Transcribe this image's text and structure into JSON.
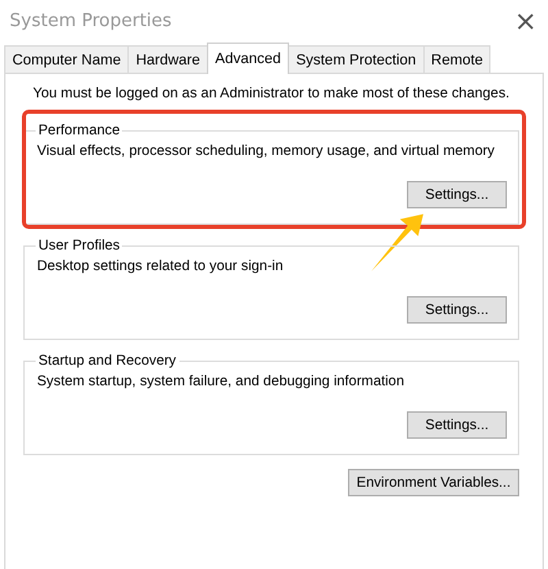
{
  "window": {
    "title": "System Properties",
    "close": "×"
  },
  "tabs": [
    {
      "label": "Computer Name",
      "selected": false
    },
    {
      "label": "Hardware",
      "selected": false
    },
    {
      "label": "Advanced",
      "selected": true
    },
    {
      "label": "System Protection",
      "selected": false
    },
    {
      "label": "Remote",
      "selected": false
    }
  ],
  "notice": "You must be logged on as an Administrator to make most of these changes.",
  "groups": [
    {
      "title": "Performance",
      "description": "Visual effects, processor scheduling, memory usage, and virtual memory",
      "button": "Settings...",
      "highlighted": true
    },
    {
      "title": "User Profiles",
      "description": "Desktop settings related to your sign-in",
      "button": "Settings...",
      "highlighted": false
    },
    {
      "title": "Startup and Recovery",
      "description": "System startup, system failure, and debugging information",
      "button": "Settings...",
      "highlighted": false
    }
  ],
  "bottom_button": "Environment Variables..."
}
